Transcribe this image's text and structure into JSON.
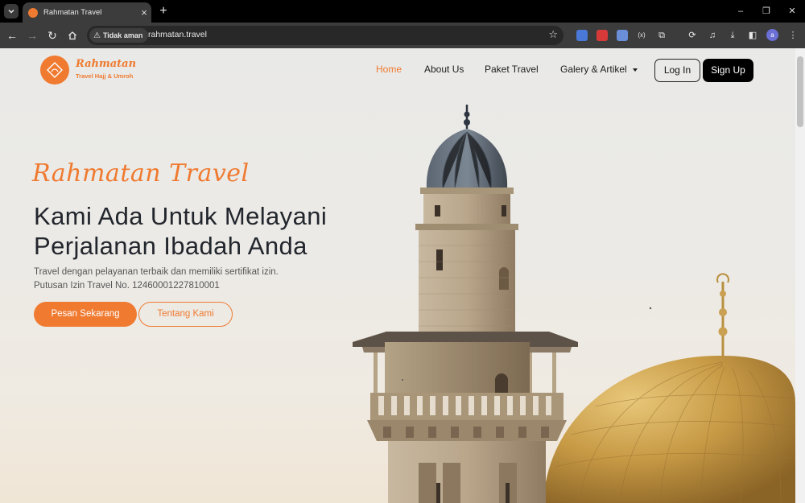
{
  "browser": {
    "tab": {
      "title": "Rahmatan Travel"
    },
    "security_chip": "Tidak aman",
    "url": "rahmatan.travel",
    "profile_initial": "a",
    "window_controls": [
      "–",
      "❐",
      "✕"
    ]
  },
  "site": {
    "logo": {
      "name": "Rahmatan",
      "tagline": "Travel Hajj & Umroh"
    },
    "nav": [
      {
        "label": "Home",
        "active": true
      },
      {
        "label": "About Us"
      },
      {
        "label": "Paket Travel"
      },
      {
        "label": "Galery & Artikel",
        "dropdown": true
      }
    ],
    "login_label": "Log In",
    "signup_label": "Sign Up"
  },
  "hero": {
    "script_title": "Rahmatan Travel",
    "headline_line1": "Kami Ada Untuk Melayani",
    "headline_line2": "Perjalanan Ibadah Anda",
    "desc_line1": "Travel dengan pelayanan terbaik dan memiliki sertifikat izin.",
    "desc_line2": "Putusan Izin Travel No. 1246000122781000​1",
    "primary_button": "Pesan Sekarang",
    "secondary_button": "Tentang Kami"
  },
  "colors": {
    "accent": "#ef7a30",
    "dark_button": "#000000",
    "headline": "#22262d"
  }
}
